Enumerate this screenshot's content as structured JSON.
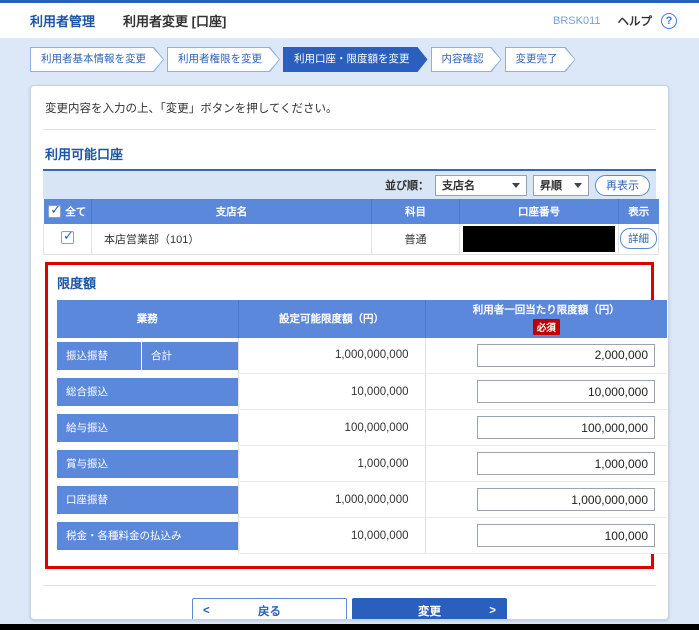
{
  "header": {
    "app_title": "利用者管理",
    "page_title": "利用者変更 [口座]",
    "screen_id": "BRSK011",
    "help_label": "ヘルプ",
    "help_glyph": "?"
  },
  "breadcrumb": {
    "steps": [
      {
        "label": "利用者基本情報を変更",
        "active": false
      },
      {
        "label": "利用者権限を変更",
        "active": false
      },
      {
        "label": "利用口座・限度額を変更",
        "active": true
      },
      {
        "label": "内容確認",
        "active": false
      },
      {
        "label": "変更完了",
        "active": false
      }
    ]
  },
  "instruction": "変更内容を入力の上、「変更」ボタンを押してください。",
  "accounts": {
    "title": "利用可能口座",
    "sort": {
      "label": "並び順：",
      "sort_key": "支店名",
      "sort_order": "昇順",
      "refresh_label": "再表示"
    },
    "columns": {
      "select_all": "全て",
      "branch": "支店名",
      "type": "科目",
      "number": "口座番号",
      "show": "表示"
    },
    "row": {
      "branch": "本店営業部（101）",
      "type": "普通",
      "detail_label": "詳細"
    },
    "check_glyph": "✓"
  },
  "limits": {
    "title": "限度額",
    "columns": {
      "category": "業務",
      "max": "設定可能限度額（円）",
      "per_use": "利用者一回当たり限度額（円）",
      "required_badge": "必須"
    },
    "rows": [
      {
        "category": "振込振替",
        "sub": "合計",
        "max": "1,000,000,000",
        "value": "2,000,000"
      },
      {
        "category": "総合振込",
        "max": "10,000,000",
        "value": "10,000,000"
      },
      {
        "category": "給与振込",
        "max": "100,000,000",
        "value": "100,000,000"
      },
      {
        "category": "賞与振込",
        "max": "1,000,000",
        "value": "1,000,000"
      },
      {
        "category": "口座振替",
        "max": "1,000,000,000",
        "value": "1,000,000,000"
      },
      {
        "category": "税金・各種料金の払込み",
        "max": "10,000,000",
        "value": "100,000"
      }
    ]
  },
  "footer": {
    "back_label": "戻る",
    "submit_label": "変更",
    "chevron_left": "<",
    "chevron_right": ">"
  },
  "colors": {
    "accent_blue": "#2b5fbd",
    "table_header_blue": "#5c88dc",
    "title_blue": "#1c55a5",
    "highlight_red": "#dd0000",
    "required_red": "#c00000",
    "page_background": "#dce8f7"
  }
}
